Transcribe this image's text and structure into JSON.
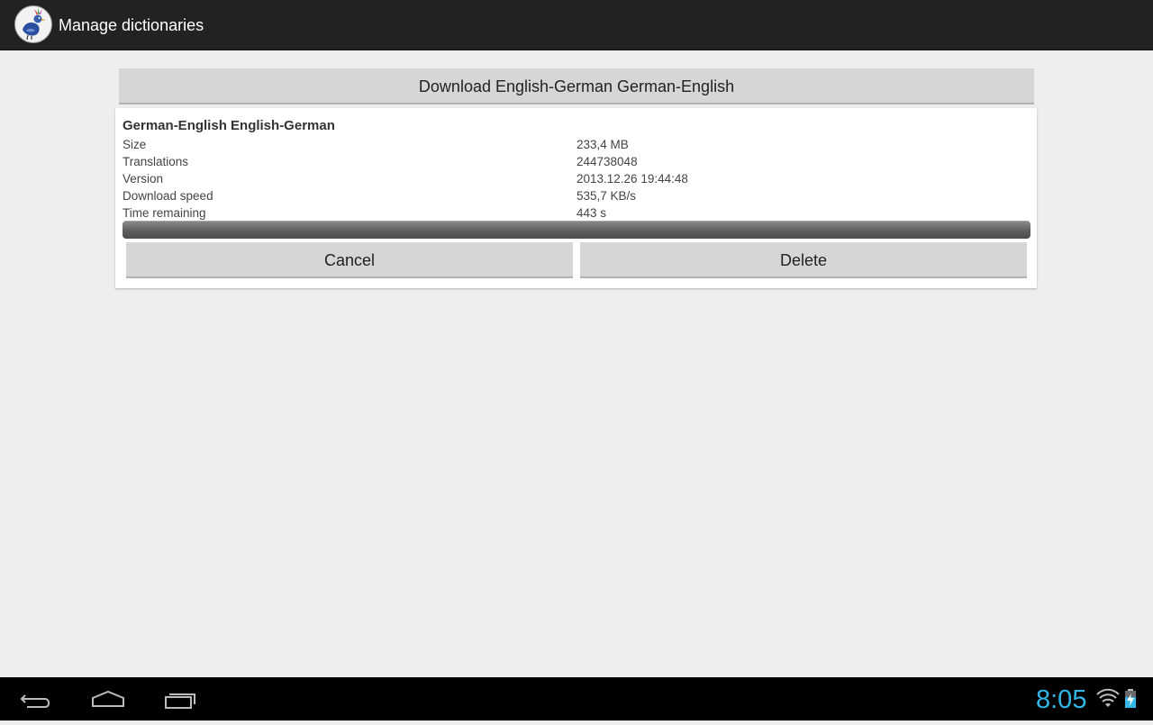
{
  "action_bar": {
    "title": "Manage dictionaries",
    "icon": "app-logo-icon"
  },
  "download_button": {
    "label": "Download English-German German-English"
  },
  "dictionary": {
    "title": "German-English English-German",
    "info": [
      {
        "label": "Size",
        "value": "233,4 MB"
      },
      {
        "label": "Translations",
        "value": "244738048"
      },
      {
        "label": "Version",
        "value": "2013.12.26 19:44:48"
      },
      {
        "label": "Download speed",
        "value": "535,7 KB/s"
      },
      {
        "label": "Time remaining",
        "value": "443 s"
      }
    ],
    "progress": 0,
    "cancel_label": "Cancel",
    "delete_label": "Delete"
  },
  "nav_bar": {
    "icons": [
      "back-icon",
      "home-icon",
      "recent-apps-icon"
    ]
  },
  "status_bar": {
    "time": "8:05",
    "icons": [
      "wifi-icon",
      "battery-charging-icon"
    ],
    "accent": "#33b5e5"
  }
}
